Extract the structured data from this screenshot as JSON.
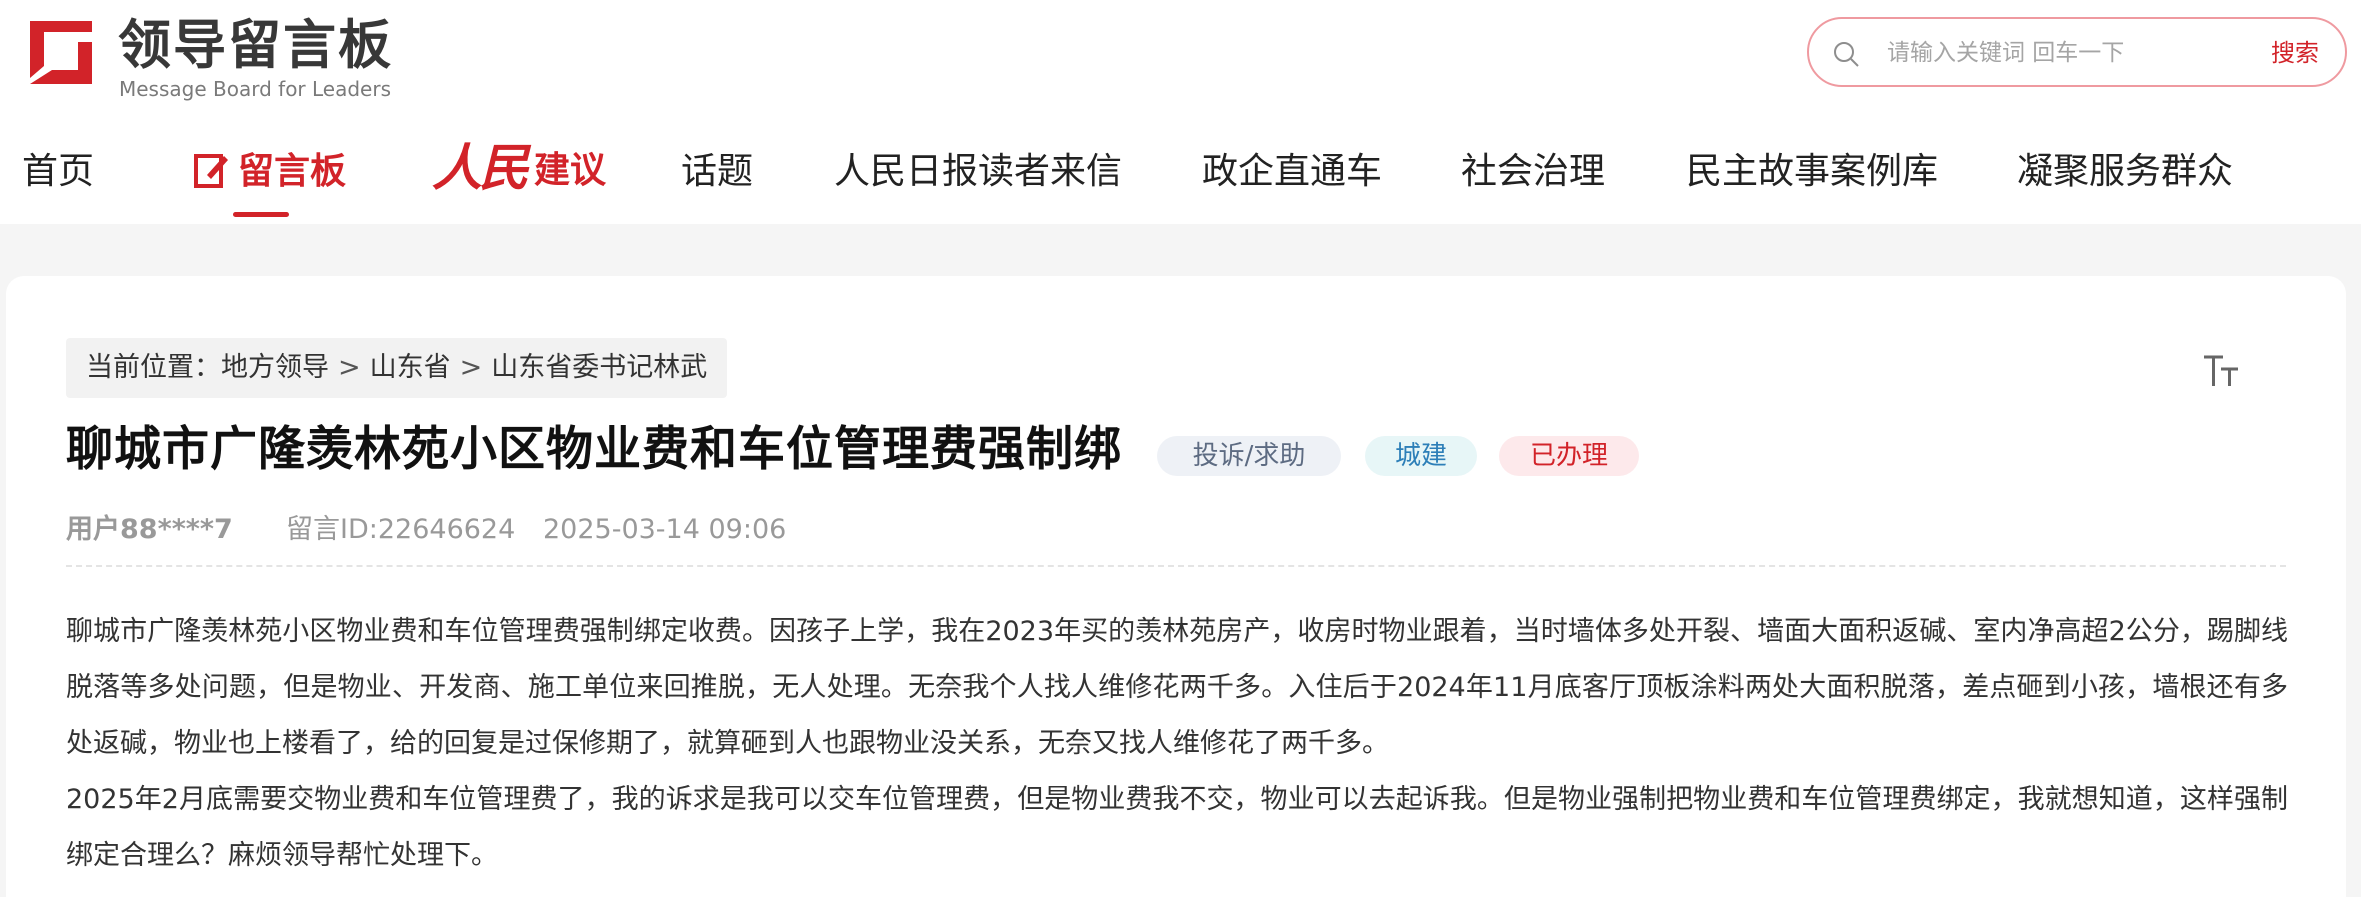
{
  "header": {
    "logo_title": "领导留言板",
    "logo_subtitle": "Message Board for Leaders",
    "search_placeholder": "请输入关键词 回车一下",
    "search_button": "搜索",
    "accent_color": "#d22329"
  },
  "nav": {
    "items": [
      {
        "label": "首页"
      },
      {
        "label": "留言板"
      },
      {
        "label": "人民",
        "suffix": "建议"
      },
      {
        "label": "话题"
      },
      {
        "label": "人民日报读者来信"
      },
      {
        "label": "政企直通车"
      },
      {
        "label": "社会治理"
      },
      {
        "label": "民主故事案例库"
      },
      {
        "label": "凝聚服务群众"
      }
    ],
    "active": "留言板"
  },
  "breadcrumb": {
    "prefix": "当前位置：",
    "items": [
      "地方领导",
      "山东省",
      "山东省委书记林武"
    ],
    "separator": ">"
  },
  "message": {
    "title": "聊城市广隆羡林苑小区物业费和车位管理费强制绑",
    "tags": [
      "投诉/求助",
      "城建",
      "已办理"
    ],
    "user": "用户88****7",
    "id_label": "留言ID:22646624",
    "timestamp": "2025-03-14 09:06",
    "paragraphs": [
      "聊城市广隆羡林苑小区物业费和车位管理费强制绑定收费。因孩子上学，我在2023年买的羡林苑房产，收房时物业跟着，当时墙体多处开裂、墙面大面积返碱、室内净高超2公分，踢脚线脱落等多处问题，但是物业、开发商、施工单位来回推脱，无人处理。无奈我个人找人维修花两千多。入住后于2024年11月底客厅顶板涂料两处大面积脱落，差点砸到小孩，墙根还有多处返碱，物业也上楼看了，给的回复是过保修期了，就算砸到人也跟物业没关系，无奈又找人维修花了两千多。",
      "2025年2月底需要交物业费和车位管理费了，我的诉求是我可以交车位管理费，但是物业费我不交，物业可以去起诉我。但是物业强制把物业费和车位管理费绑定，我就想知道，这样强制绑定合理么？麻烦领导帮忙处理下。"
    ]
  },
  "icons": [
    "logo-mark-icon",
    "search-icon",
    "edit-icon",
    "font-size-icon"
  ]
}
